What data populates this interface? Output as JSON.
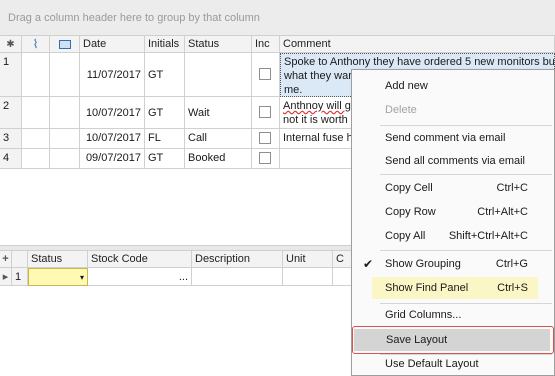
{
  "group_panel": {
    "hint": "Drag a column header here to group by that column"
  },
  "upper_grid": {
    "columns": {
      "date": "Date",
      "initials": "Initials",
      "status": "Status",
      "inc": "Inc",
      "comment": "Comment"
    },
    "rows": [
      {
        "num": "1",
        "date": "11/07/2017",
        "initials": "GT",
        "status": "",
        "comment_lines": [
          "Spoke to Anthony they have ordered 5 new monitors bu",
          "what they war",
          "me."
        ]
      },
      {
        "num": "2",
        "date": "10/07/2017",
        "initials": "GT",
        "status": "Wait",
        "comment_lines": [
          "Anthnoy will g",
          "not it is worth"
        ]
      },
      {
        "num": "3",
        "date": "10/07/2017",
        "initials": "FL",
        "status": "Call",
        "comment_lines": [
          "Internal fuse h"
        ]
      },
      {
        "num": "4",
        "date": "09/07/2017",
        "initials": "GT",
        "status": "Booked",
        "comment_lines": [
          ""
        ]
      }
    ]
  },
  "lower_grid": {
    "columns": {
      "status": "Status",
      "stock_code": "Stock Code",
      "description": "Description",
      "unit": "Unit",
      "c": "C"
    },
    "rows": [
      {
        "num": "1",
        "status": "",
        "stock_code": "",
        "ellipsis": "...",
        "description": "",
        "unit": ""
      }
    ]
  },
  "context_menu": {
    "add_new": "Add new",
    "delete": "Delete",
    "send_comment": "Send comment via email",
    "send_all_comments": "Send all comments via email",
    "copy_cell": {
      "label": "Copy Cell",
      "shortcut": "Ctrl+C"
    },
    "copy_row": {
      "label": "Copy Row",
      "shortcut": "Ctrl+Alt+C"
    },
    "copy_all": {
      "label": "Copy All",
      "shortcut": "Shift+Ctrl+Alt+C"
    },
    "show_grouping": {
      "label": "Show Grouping",
      "shortcut": "Ctrl+G",
      "checked": true
    },
    "show_find_panel": {
      "label": "Show Find Panel",
      "shortcut": "Ctrl+S"
    },
    "grid_columns": "Grid Columns...",
    "save_layout": "Save Layout",
    "use_default_layout": "Use Default Layout"
  },
  "colors": {
    "highlight_yellow": "#fbf6c6",
    "hover_gray": "#d4d4d4",
    "annotation_red": "#d9534f",
    "selected_cell_blue": "#dbe9f7",
    "yellow_cell": "#fff9b3"
  }
}
